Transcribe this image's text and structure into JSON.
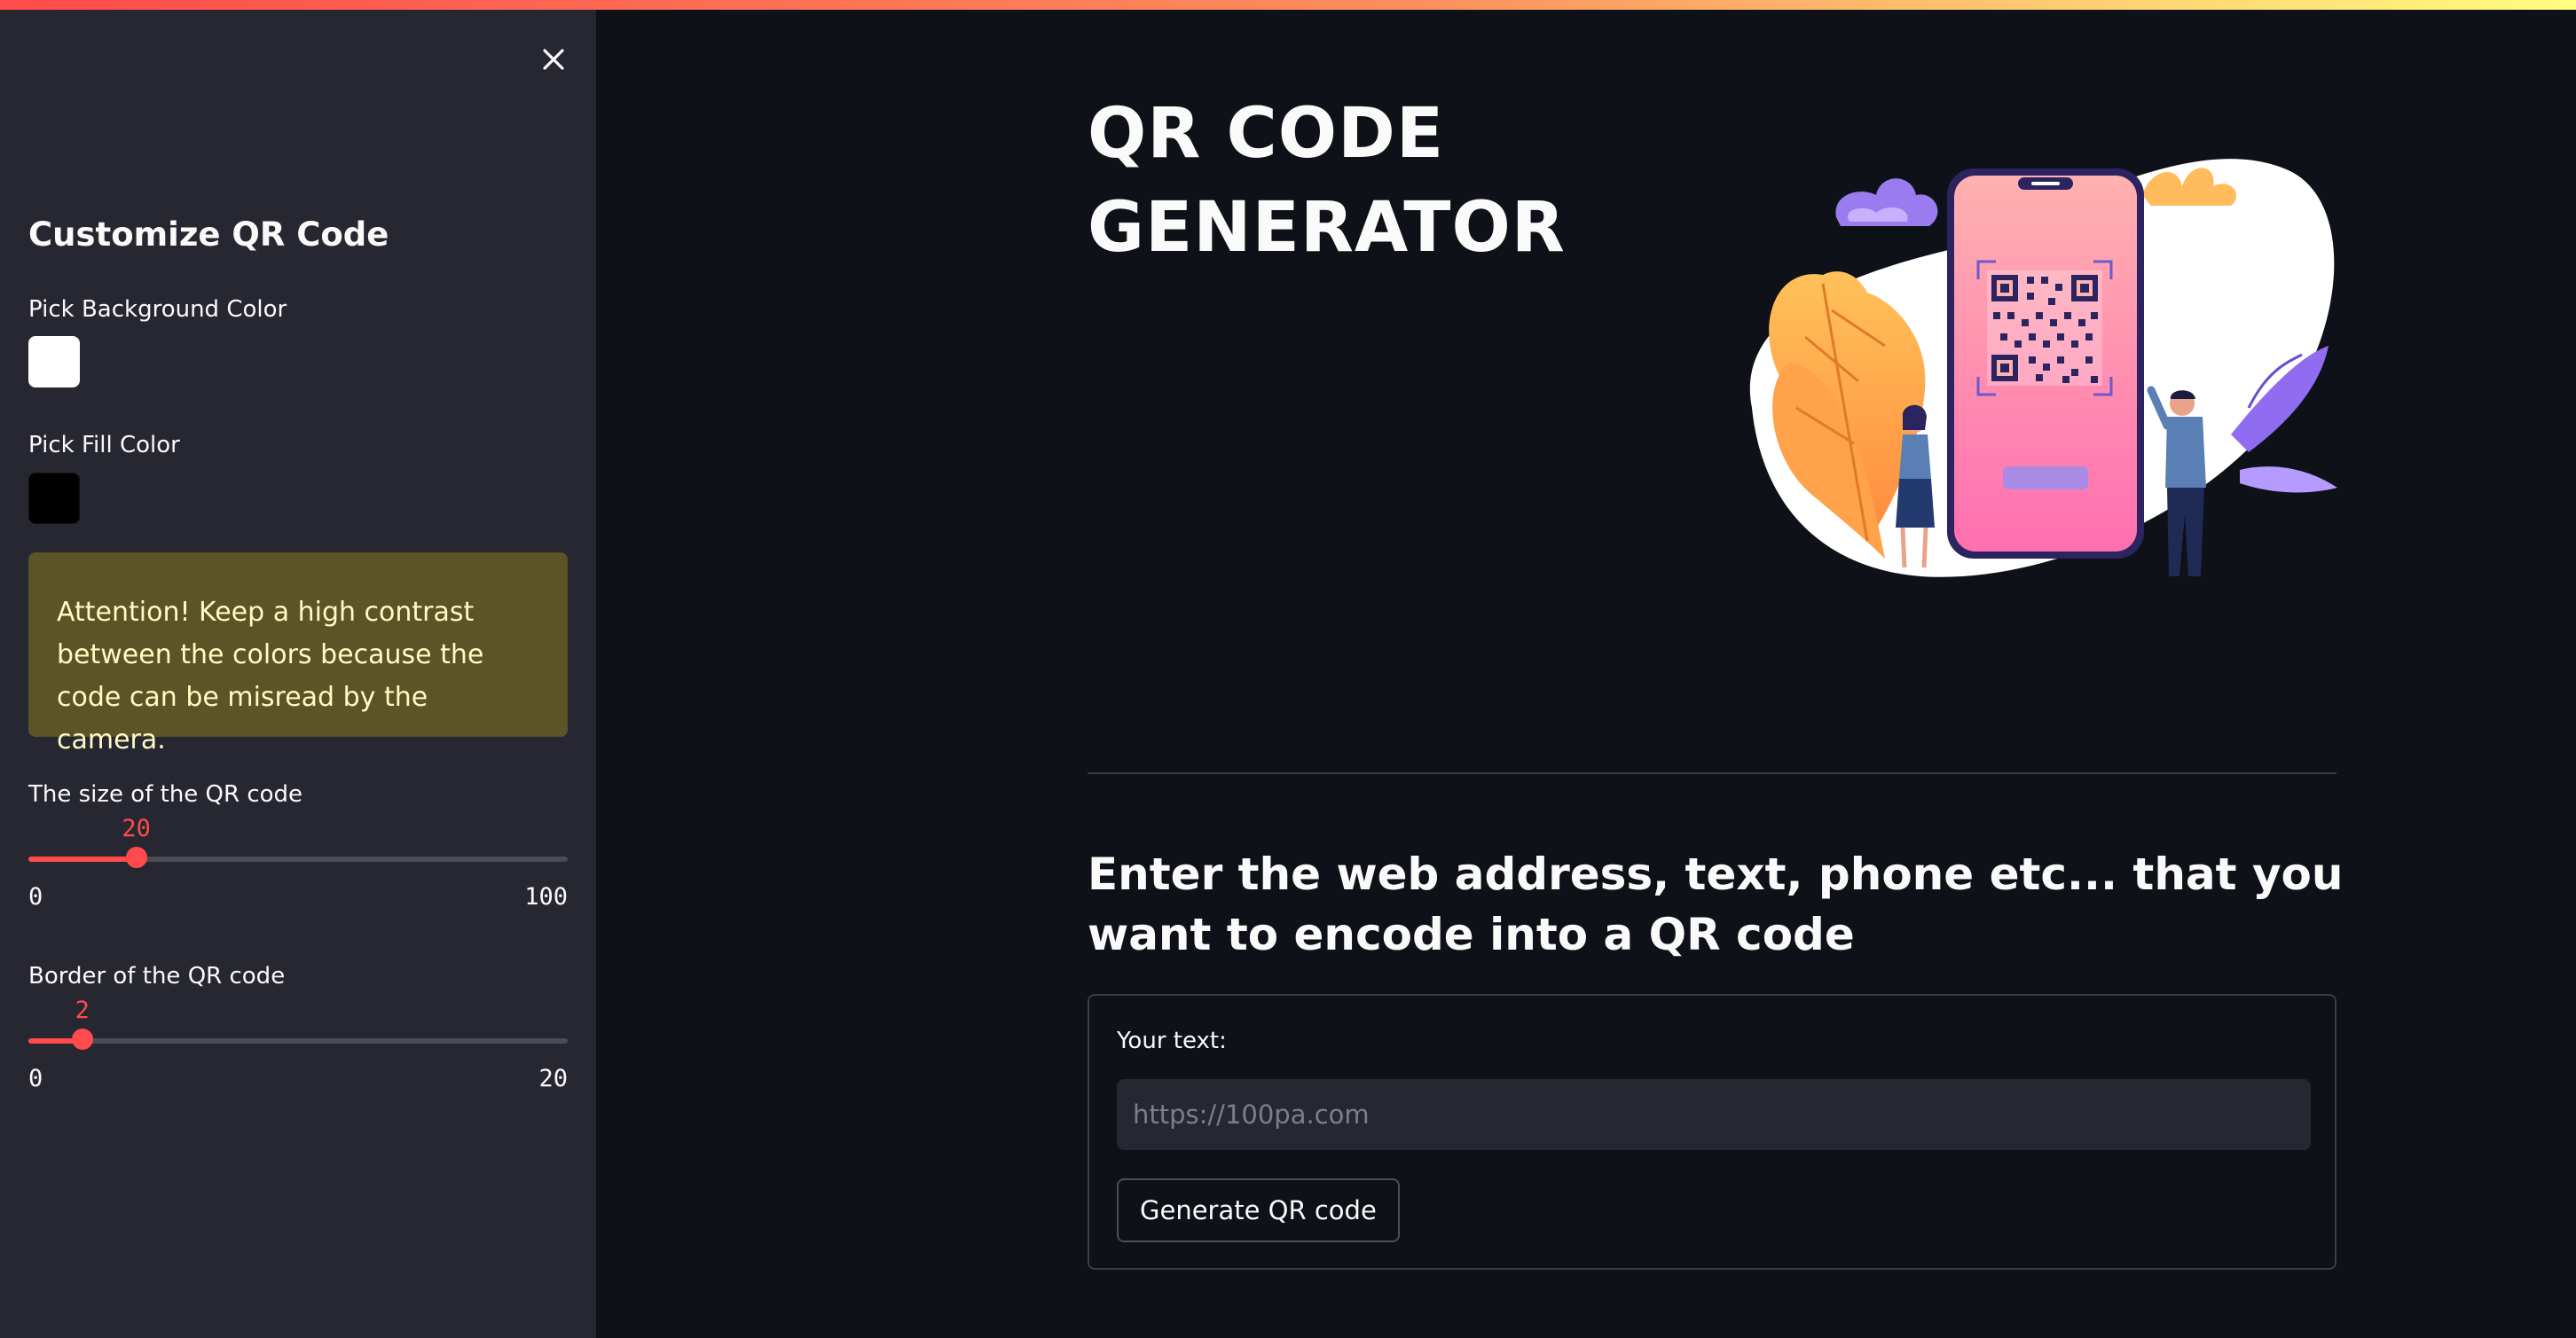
{
  "theme": {
    "accent": "#ff4b4b",
    "background": "#0e1117",
    "sidebar_background": "#262730",
    "warning_background": "#5a5427",
    "warning_text": "#fffbc2"
  },
  "sidebar": {
    "close_icon": "close-icon",
    "title": "Customize QR Code",
    "background_color": {
      "label": "Pick Background Color",
      "value": "#ffffff"
    },
    "fill_color": {
      "label": "Pick Fill Color",
      "value": "#000000"
    },
    "warning": "Attention! Keep a high contrast between the colors because the code can be misread by the camera.",
    "size_slider": {
      "label": "The size of the QR code",
      "value": "20",
      "min": "0",
      "max": "100"
    },
    "border_slider": {
      "label": "Border of the QR code",
      "value": "2",
      "min": "0",
      "max": "20"
    }
  },
  "main": {
    "title_line1": "QR CODE",
    "title_line2": "GENERATOR",
    "hero_image": "qr-code-phone-illustration",
    "subheading": "Enter the web address, text, phone etc... that you want to encode into a QR code",
    "form": {
      "label": "Your text:",
      "placeholder": "https://100pa.com",
      "value": "",
      "button_label": "Generate QR code"
    }
  }
}
